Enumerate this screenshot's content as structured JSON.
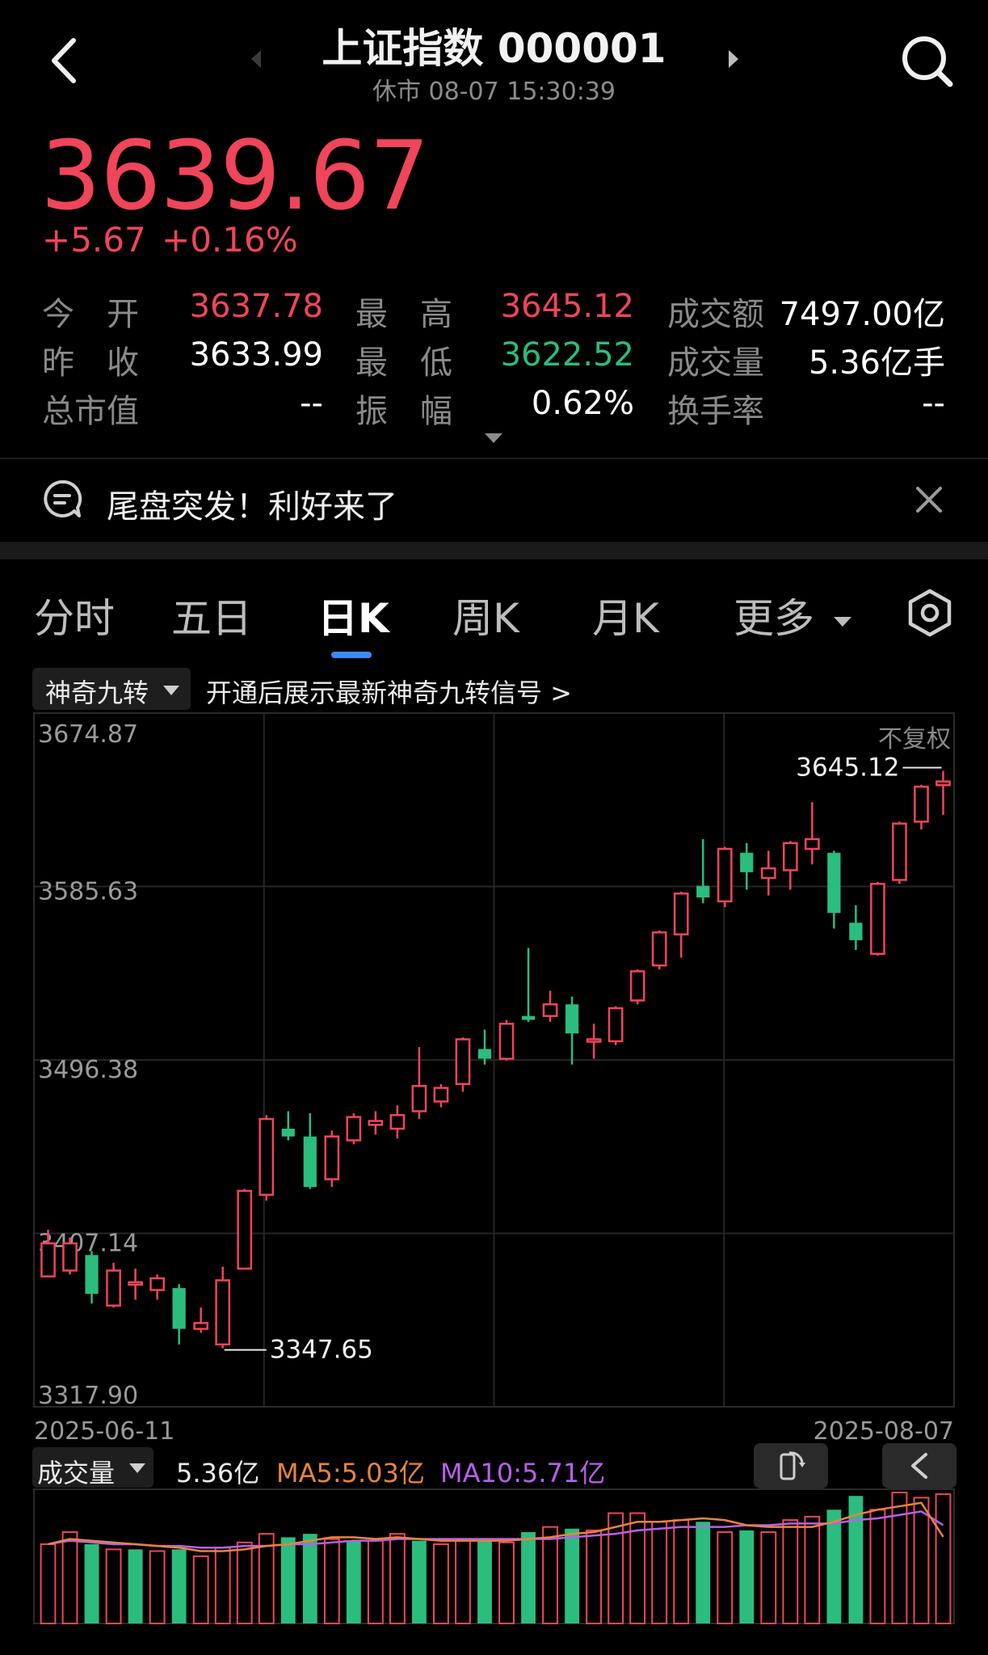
{
  "header": {
    "title": "上证指数 000001",
    "subtitle": "休市 08-07 15:30:39",
    "icons": {
      "back": "chevron-left-icon",
      "search": "search-icon",
      "prev": "triangle-left-icon",
      "next": "triangle-right-icon"
    }
  },
  "quote": {
    "price": "3639.67",
    "change_abs": "+5.67",
    "change_pct": "+0.16%"
  },
  "stats": [
    {
      "label": "今　开",
      "value": "3637.78",
      "color": "#f0455a"
    },
    {
      "label": "最　高",
      "value": "3645.12",
      "color": "#f0455a"
    },
    {
      "label": "成交额",
      "value": "7497.00亿",
      "color": "#ffffff"
    },
    {
      "label": "昨　收",
      "value": "3633.99",
      "color": "#ffffff"
    },
    {
      "label": "最　低",
      "value": "3622.52",
      "color": "#2bbd7e"
    },
    {
      "label": "成交量",
      "value": "5.36亿手",
      "color": "#ffffff"
    },
    {
      "label": "总市值",
      "value": "--",
      "color": "#ffffff"
    },
    {
      "label": "振　幅",
      "value": "0.62%",
      "color": "#ffffff"
    },
    {
      "label": "换手率",
      "value": "--",
      "color": "#ffffff"
    }
  ],
  "news": {
    "text": "尾盘突发！利好来了"
  },
  "tabs": {
    "intraday": "分时",
    "five_day": "五日",
    "day_k": "日K",
    "week_k": "周K",
    "month_k": "月K",
    "more": "更多",
    "active": "日K"
  },
  "indicator": {
    "label": "神奇九转",
    "hint": "开通后展示最新神奇九转信号 >"
  },
  "chart_data": {
    "type": "candlestick",
    "adjust_label": "不复权",
    "y_ticks": [
      "3674.87",
      "3585.63",
      "3496.38",
      "3407.14",
      "3317.90"
    ],
    "ylim": [
      3317.9,
      3674.87
    ],
    "x_start_label": "2025-06-11",
    "x_end_label": "2025-08-07",
    "max_annotation": "3645.12",
    "min_annotation": "3347.65",
    "colors": {
      "up": "#f0455a",
      "down": "#2bbd7e"
    },
    "candles": [
      {
        "o": 3385,
        "c": 3402,
        "h": 3409,
        "l": 3385
      },
      {
        "o": 3388,
        "c": 3402,
        "h": 3405,
        "l": 3386
      },
      {
        "o": 3396,
        "c": 3376,
        "h": 3398,
        "l": 3371
      },
      {
        "o": 3370,
        "c": 3388,
        "h": 3392,
        "l": 3369
      },
      {
        "o": 3381,
        "c": 3382,
        "h": 3389,
        "l": 3373
      },
      {
        "o": 3378,
        "c": 3384,
        "h": 3386,
        "l": 3373
      },
      {
        "o": 3379,
        "c": 3358,
        "h": 3381,
        "l": 3350
      },
      {
        "o": 3358,
        "c": 3361,
        "h": 3369,
        "l": 3356
      },
      {
        "o": 3350,
        "c": 3383,
        "h": 3390,
        "l": 3348
      },
      {
        "o": 3389,
        "c": 3429,
        "h": 3430,
        "l": 3389
      },
      {
        "o": 3427,
        "c": 3466,
        "h": 3468,
        "l": 3424
      },
      {
        "o": 3461,
        "c": 3457,
        "h": 3470,
        "l": 3455
      },
      {
        "o": 3457,
        "c": 3431,
        "h": 3469,
        "l": 3430
      },
      {
        "o": 3435,
        "c": 3457,
        "h": 3460,
        "l": 3431
      },
      {
        "o": 3455,
        "c": 3467,
        "h": 3469,
        "l": 3453
      },
      {
        "o": 3463,
        "c": 3465,
        "h": 3470,
        "l": 3458
      },
      {
        "o": 3461,
        "c": 3468,
        "h": 3473,
        "l": 3456
      },
      {
        "o": 3470,
        "c": 3483,
        "h": 3503,
        "l": 3466
      },
      {
        "o": 3475,
        "c": 3482,
        "h": 3484,
        "l": 3472
      },
      {
        "o": 3484,
        "c": 3507,
        "h": 3508,
        "l": 3480
      },
      {
        "o": 3502,
        "c": 3497,
        "h": 3512,
        "l": 3494
      },
      {
        "o": 3497,
        "c": 3515,
        "h": 3517,
        "l": 3496
      },
      {
        "o": 3519,
        "c": 3517,
        "h": 3554,
        "l": 3516
      },
      {
        "o": 3519,
        "c": 3525,
        "h": 3532,
        "l": 3516
      },
      {
        "o": 3525,
        "c": 3510,
        "h": 3529,
        "l": 3494
      },
      {
        "o": 3506,
        "c": 3507,
        "h": 3515,
        "l": 3497
      },
      {
        "o": 3506,
        "c": 3523,
        "h": 3524,
        "l": 3504
      },
      {
        "o": 3527,
        "c": 3542,
        "h": 3543,
        "l": 3525
      },
      {
        "o": 3545,
        "c": 3562,
        "h": 3563,
        "l": 3543
      },
      {
        "o": 3561,
        "c": 3582,
        "h": 3583,
        "l": 3549
      },
      {
        "o": 3586,
        "c": 3580,
        "h": 3610,
        "l": 3577
      },
      {
        "o": 3578,
        "c": 3605,
        "h": 3606,
        "l": 3575
      },
      {
        "o": 3603,
        "c": 3593,
        "h": 3608,
        "l": 3584
      },
      {
        "o": 3590,
        "c": 3595,
        "h": 3604,
        "l": 3581
      },
      {
        "o": 3594,
        "c": 3608,
        "h": 3609,
        "l": 3584
      },
      {
        "o": 3605,
        "c": 3610,
        "h": 3629,
        "l": 3597
      },
      {
        "o": 3603,
        "c": 3572,
        "h": 3604,
        "l": 3564
      },
      {
        "o": 3567,
        "c": 3558,
        "h": 3576,
        "l": 3553
      },
      {
        "o": 3551,
        "c": 3587,
        "h": 3588,
        "l": 3550
      },
      {
        "o": 3589,
        "c": 3618,
        "h": 3619,
        "l": 3587
      },
      {
        "o": 3619,
        "c": 3637,
        "h": 3638,
        "l": 3615
      },
      {
        "o": 3637.78,
        "c": 3639.67,
        "h": 3645.12,
        "l": 3622.52
      }
    ]
  },
  "volume": {
    "label": "成交量",
    "value_text": "5.36亿",
    "ma5_text": "MA5:5.03亿",
    "ma10_text": "MA10:5.71亿",
    "ma5_color": "#e8843c",
    "ma10_color": "#b760e8",
    "icons": {
      "rotate": "rotate-screen-icon",
      "collapse": "chevron-left-icon"
    },
    "bars": [
      4.6,
      5.3,
      4.6,
      4.3,
      4.3,
      4.2,
      4.3,
      3.9,
      4.4,
      4.7,
      5.2,
      5.0,
      5.2,
      4.9,
      4.8,
      4.8,
      5.2,
      4.8,
      4.6,
      4.8,
      4.9,
      4.7,
      5.3,
      5.6,
      5.5,
      5.4,
      6.4,
      6.4,
      5.9,
      6.0,
      5.9,
      5.3,
      5.4,
      5.3,
      6.0,
      6.2,
      6.6,
      7.4,
      6.6,
      7.6,
      7.3,
      7.5
    ],
    "ma5": [
      4.6,
      4.9,
      4.8,
      4.7,
      4.6,
      4.5,
      4.4,
      4.2,
      4.2,
      4.3,
      4.5,
      4.6,
      4.8,
      5.0,
      5.0,
      4.9,
      5.0,
      4.9,
      4.8,
      4.8,
      4.8,
      4.8,
      4.9,
      5.0,
      5.2,
      5.3,
      5.6,
      5.9,
      5.9,
      6.0,
      6.1,
      6.0,
      5.7,
      5.6,
      5.6,
      5.6,
      5.9,
      6.3,
      6.6,
      6.8,
      7.0,
      5.03
    ],
    "ma10": [
      4.6,
      4.8,
      4.7,
      4.6,
      4.6,
      4.5,
      4.5,
      4.4,
      4.4,
      4.5,
      4.5,
      4.6,
      4.6,
      4.7,
      4.8,
      4.8,
      4.9,
      4.9,
      4.9,
      4.9,
      4.9,
      4.9,
      4.9,
      4.9,
      5.0,
      5.1,
      5.2,
      5.4,
      5.5,
      5.6,
      5.6,
      5.6,
      5.7,
      5.7,
      5.8,
      5.8,
      5.8,
      6.0,
      6.1,
      6.3,
      6.5,
      5.71
    ],
    "up_flags": [
      1,
      1,
      0,
      1,
      0,
      1,
      0,
      1,
      1,
      1,
      1,
      0,
      0,
      1,
      0,
      1,
      1,
      0,
      1,
      1,
      0,
      1,
      0,
      1,
      0,
      1,
      1,
      1,
      1,
      1,
      0,
      1,
      0,
      1,
      1,
      1,
      0,
      0,
      1,
      1,
      1,
      1
    ]
  }
}
